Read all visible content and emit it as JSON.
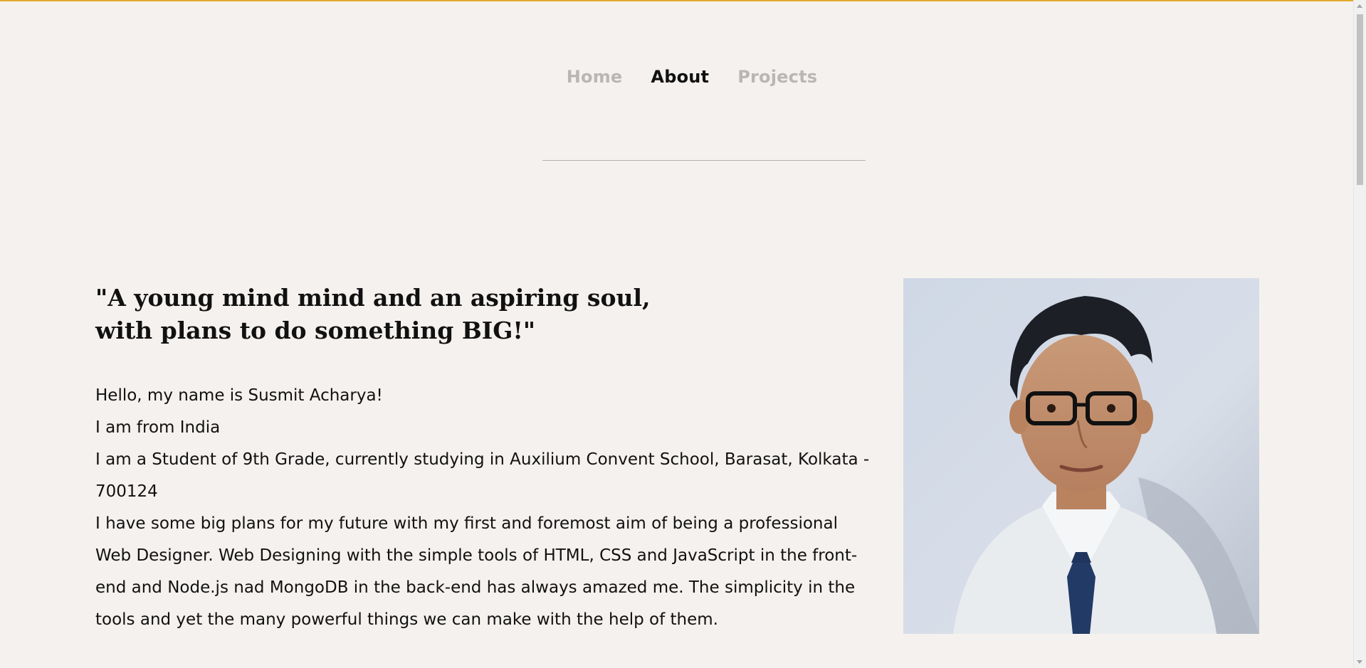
{
  "nav": {
    "items": [
      {
        "label": "Home",
        "active": false
      },
      {
        "label": "About",
        "active": true
      },
      {
        "label": "Projects",
        "active": false
      }
    ]
  },
  "about": {
    "quote": "\"A young mind mind and an aspiring soul,\nwith plans to do something BIG!\"",
    "paragraphs": [
      "Hello, my name is Susmit Acharya!",
      "I am from India",
      "I am a Student of 9th Grade, currently studying in Auxilium Convent School, Barasat, Kolkata - 700124",
      "I have some big plans for my future with my first and foremost aim of being a professional Web Designer. Web Designing with the simple tools of HTML, CSS and JavaScript in the front-end and Node.js nad MongoDB in the back-end has always amazed me. The simplicity in the tools and yet the many powerful things we can make with the help of them."
    ]
  },
  "colors": {
    "background": "#f5f1ee",
    "accent": "#e2aa2c",
    "nav_inactive": "#b9b6b4",
    "text": "#111111"
  }
}
